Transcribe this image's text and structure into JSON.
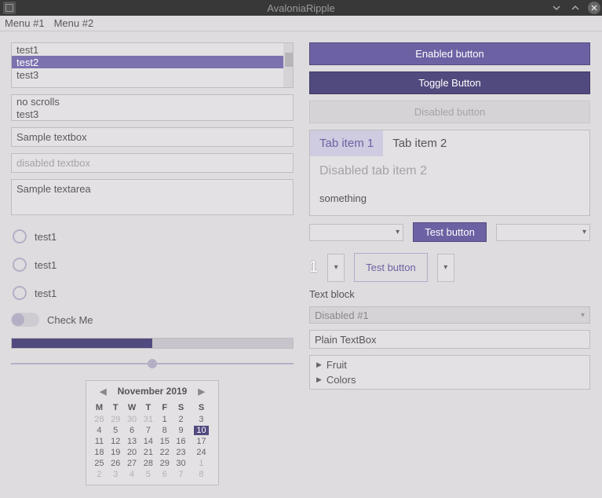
{
  "window": {
    "title": "AvaloniaRipple"
  },
  "menubar": {
    "items": [
      "Menu #1",
      "Menu #2"
    ]
  },
  "left": {
    "listbox1": {
      "items": [
        "test1",
        "test2",
        "test3"
      ],
      "selectedIndex": 1
    },
    "listbox2": {
      "items": [
        "no scrolls",
        "test3"
      ]
    },
    "textbox": "Sample textbox",
    "disabledTextbox": "disabled textbox",
    "textarea": "Sample textarea",
    "radios": [
      "test1",
      "test1",
      "test1"
    ],
    "toggleLabel": "Check Me",
    "progressValue": 50,
    "sliderValue": 50,
    "calendar": {
      "header": "November 2019",
      "dow": [
        "M",
        "T",
        "W",
        "T",
        "F",
        "S",
        "S"
      ],
      "weeks": [
        [
          {
            "d": "28",
            "o": 1
          },
          {
            "d": "29",
            "o": 1
          },
          {
            "d": "30",
            "o": 1
          },
          {
            "d": "31",
            "o": 1
          },
          {
            "d": "1"
          },
          {
            "d": "2"
          },
          {
            "d": "3"
          }
        ],
        [
          {
            "d": "4"
          },
          {
            "d": "5"
          },
          {
            "d": "6"
          },
          {
            "d": "7"
          },
          {
            "d": "8"
          },
          {
            "d": "9"
          },
          {
            "d": "10",
            "sel": 1
          }
        ],
        [
          {
            "d": "11"
          },
          {
            "d": "12"
          },
          {
            "d": "13"
          },
          {
            "d": "14"
          },
          {
            "d": "15"
          },
          {
            "d": "16"
          },
          {
            "d": "17"
          }
        ],
        [
          {
            "d": "18"
          },
          {
            "d": "19"
          },
          {
            "d": "20"
          },
          {
            "d": "21"
          },
          {
            "d": "22"
          },
          {
            "d": "23"
          },
          {
            "d": "24"
          }
        ],
        [
          {
            "d": "25"
          },
          {
            "d": "26"
          },
          {
            "d": "27"
          },
          {
            "d": "28"
          },
          {
            "d": "29"
          },
          {
            "d": "30"
          },
          {
            "d": "1",
            "o": 1
          }
        ],
        [
          {
            "d": "2",
            "o": 1
          },
          {
            "d": "3",
            "o": 1
          },
          {
            "d": "4",
            "o": 1
          },
          {
            "d": "5",
            "o": 1
          },
          {
            "d": "6",
            "o": 1
          },
          {
            "d": "7",
            "o": 1
          },
          {
            "d": "8",
            "o": 1
          }
        ]
      ]
    }
  },
  "right": {
    "buttons": {
      "enabled": "Enabled button",
      "toggle": "Toggle Button",
      "disabled": "Disabled button"
    },
    "tabs": {
      "items": [
        "Tab item 1",
        "Tab item 2"
      ],
      "disabledTab": "Disabled tab item 2",
      "content": "something"
    },
    "testButton1": "Test button",
    "spinValue": "1",
    "testButton2": "Test button",
    "textBlock": "Text block",
    "disabledCombo": "Disabled #1",
    "plainBox": "Plain TextBox",
    "tree": [
      "Fruit",
      "Colors"
    ]
  }
}
